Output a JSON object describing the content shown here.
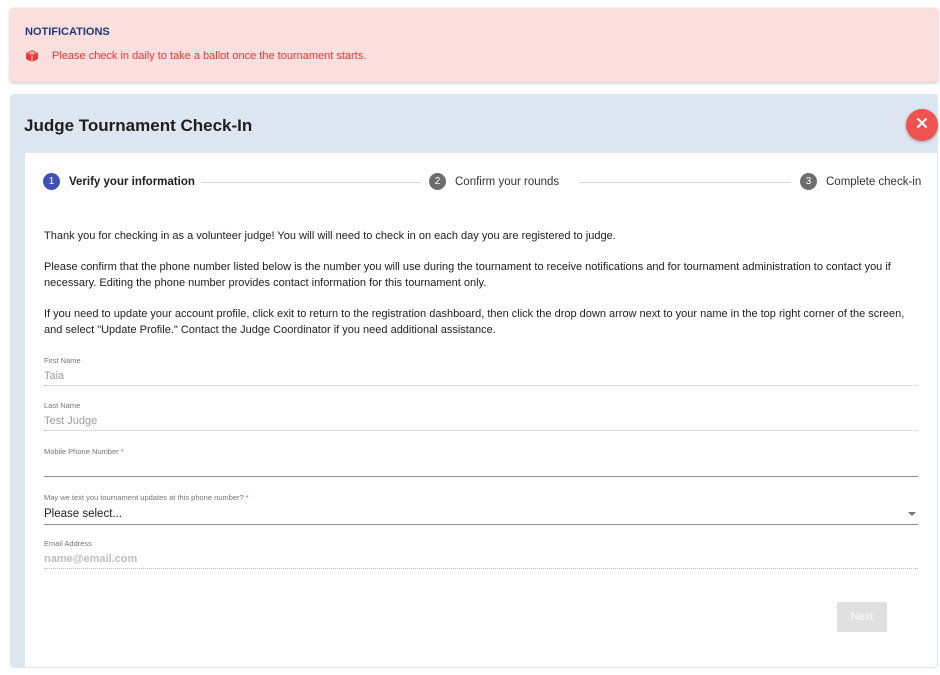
{
  "notifications": {
    "title": "NOTIFICATIONS",
    "message": "Please check in daily to take a ballot once the tournament starts.",
    "icon": "ballot-box-icon"
  },
  "card": {
    "title": "Judge Tournament Check-In",
    "close_icon": "close-icon"
  },
  "stepper": {
    "steps": [
      {
        "number": "1",
        "label": "Verify your information"
      },
      {
        "number": "2",
        "label": "Confirm your rounds"
      },
      {
        "number": "3",
        "label": "Complete check-in"
      }
    ]
  },
  "intro": {
    "p1": "Thank you for checking in as a volunteer judge! You will will need to check in on each day you are registered to judge.",
    "p2": "Please confirm that the phone number listed below is the number you will use during the tournament to receive notifications and for tournament administration to contact you if necessary. Editing the phone number provides contact information for this tournament only.",
    "p3": "If you need to update your account profile, click exit to return to the registration dashboard, then click the drop down arrow next to your name in the top right corner of the screen, and select \"Update Profile.\" Contact the Judge Coordinator if you need additional assistance."
  },
  "form": {
    "first_name": {
      "label": "First Name",
      "value": "Taia"
    },
    "last_name": {
      "label": "Last Name",
      "value": "Test Judge"
    },
    "mobile_phone": {
      "label": "Mobile Phone Number *",
      "value": ""
    },
    "text_updates": {
      "label": "May we text you tournament updates at this phone number? *",
      "value": "Please select..."
    },
    "email": {
      "label": "Email Address",
      "value": "name@email.com"
    }
  },
  "buttons": {
    "next": "Next"
  },
  "colors": {
    "notification_bg": "#fbdede",
    "notification_text": "#e53935",
    "card_bg": "#dde6f1",
    "close_button": "#ef5350",
    "active_step": "#3f51b5"
  }
}
